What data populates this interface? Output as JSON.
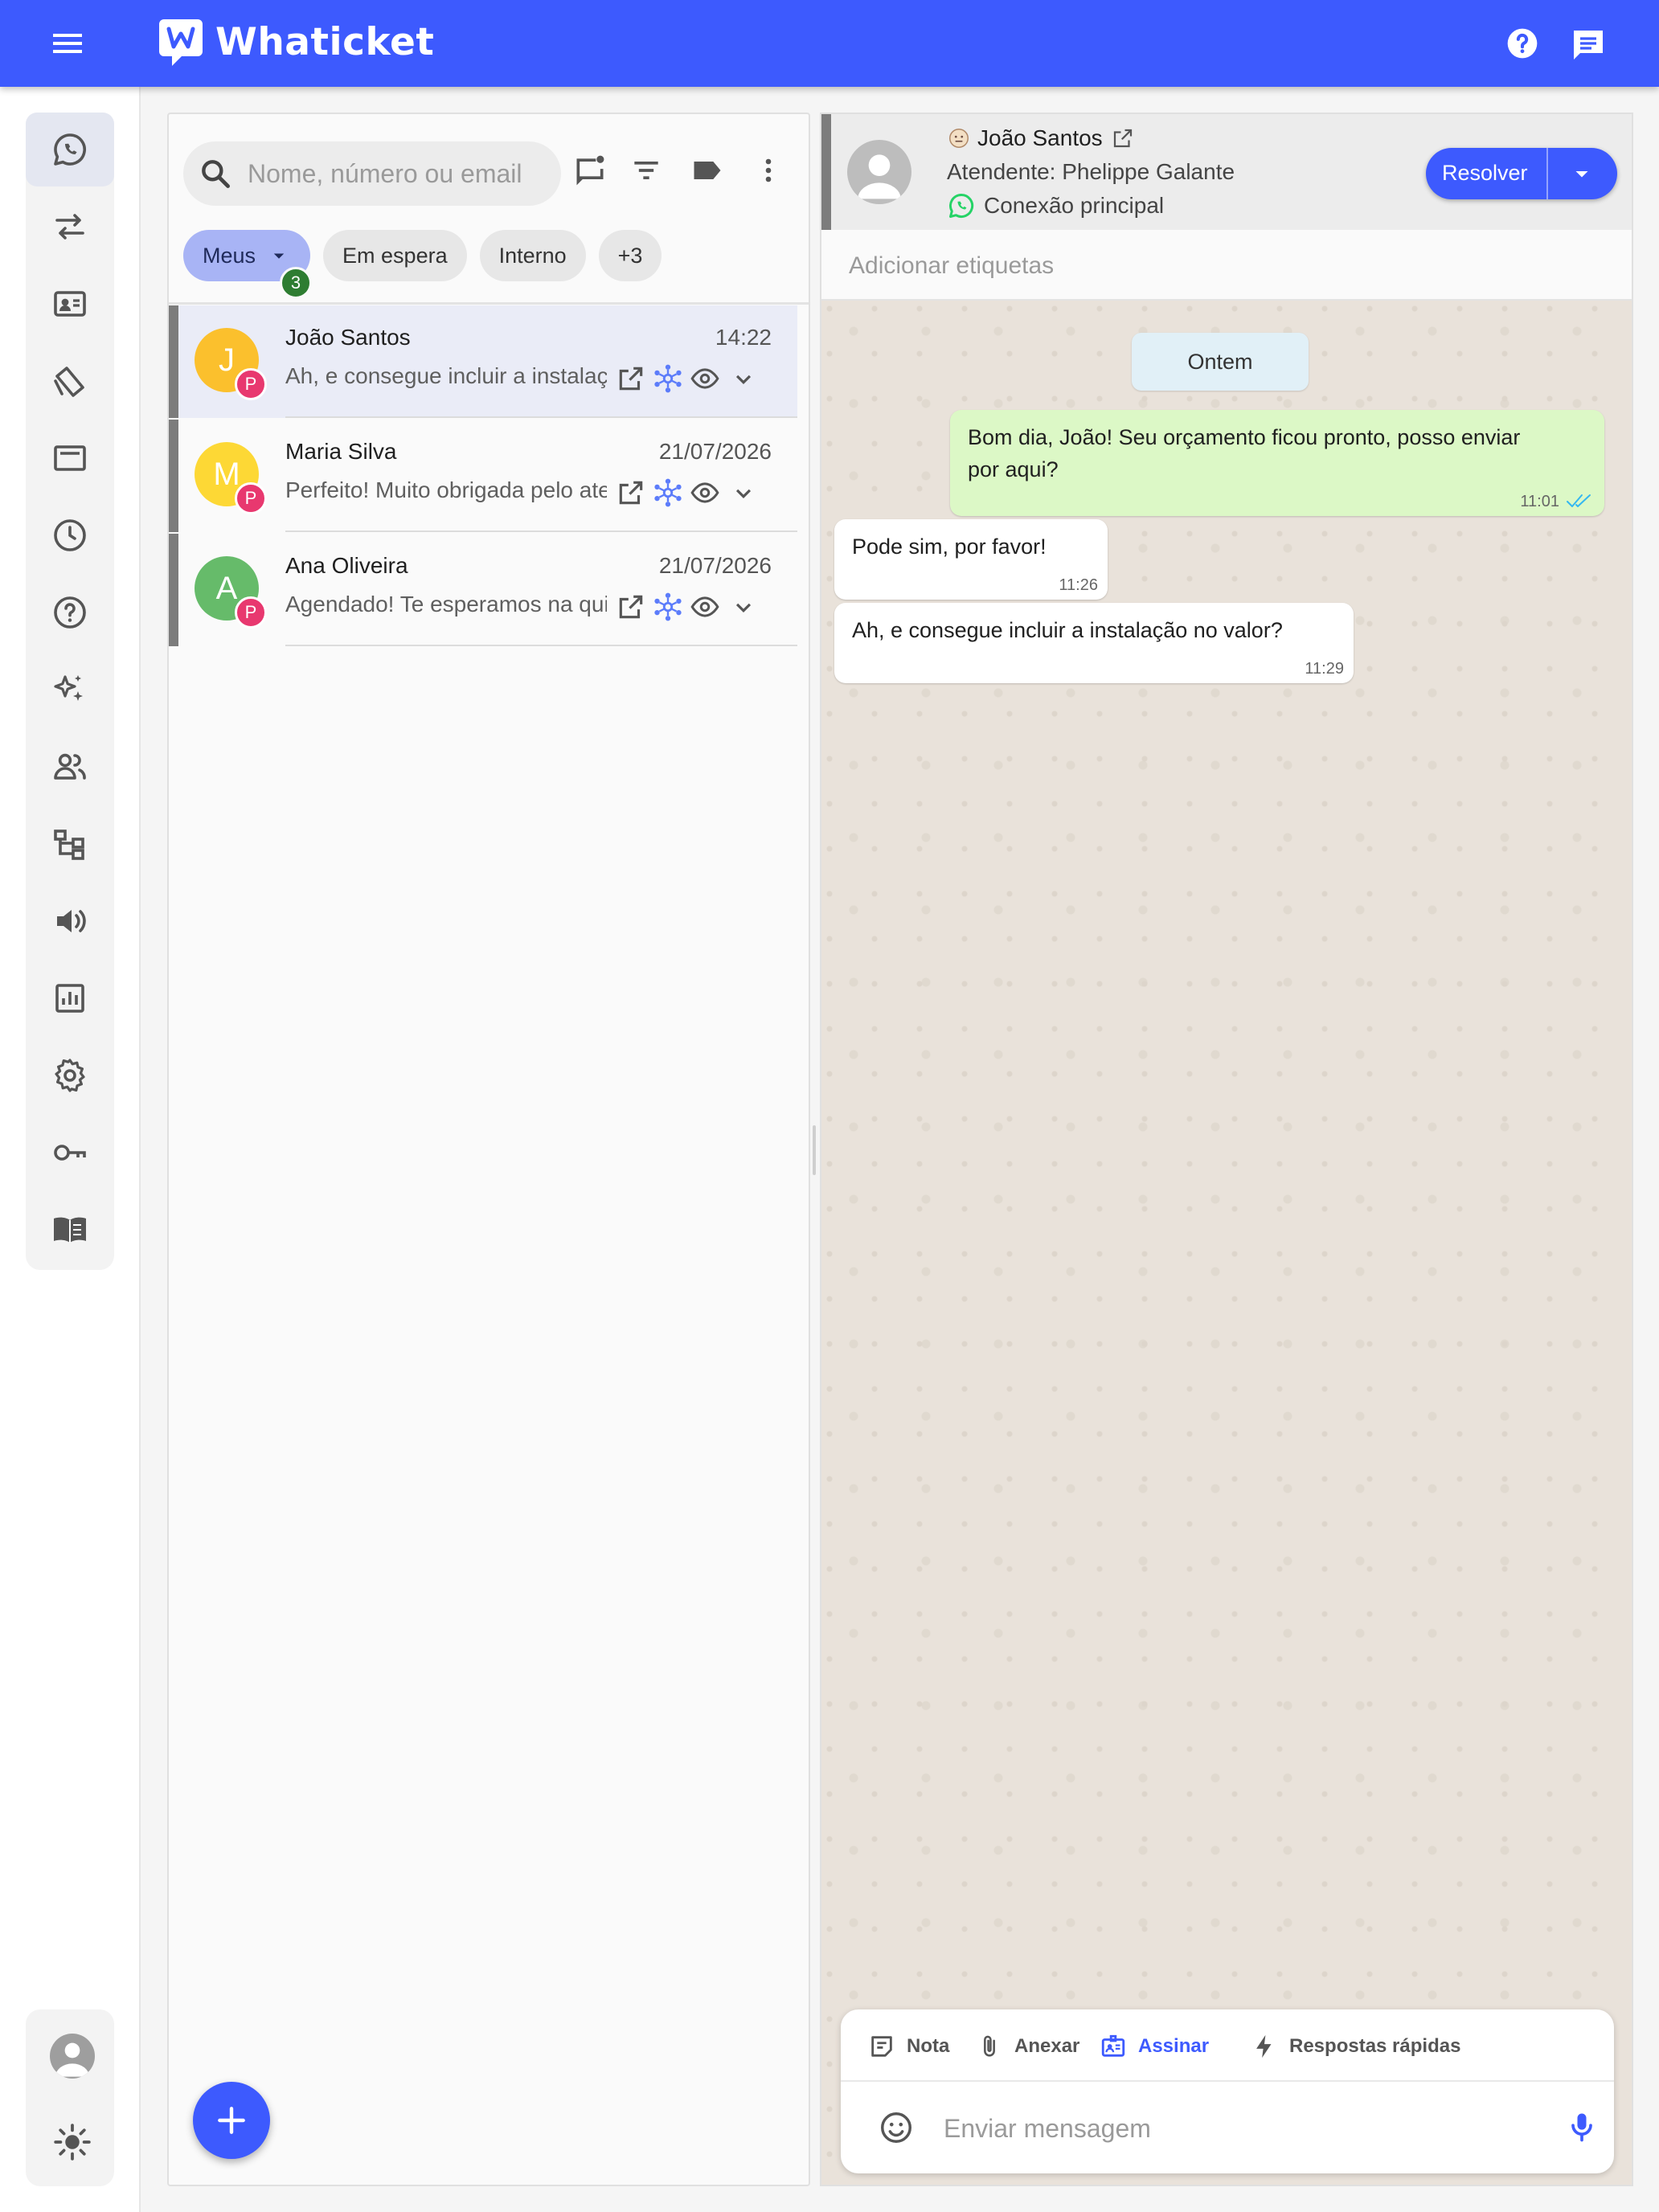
{
  "app": {
    "name": "Whaticket",
    "brand_color": "#3d5afe"
  },
  "header_icons": [
    "menu-icon",
    "help-icon",
    "chat-icon"
  ],
  "sidebar": {
    "items": [
      {
        "name": "whatsapp-icon",
        "active": true
      },
      {
        "name": "transfer-icon"
      },
      {
        "name": "contacts-icon"
      },
      {
        "name": "tags-icon"
      },
      {
        "name": "quick-messages-icon"
      },
      {
        "name": "schedule-icon"
      },
      {
        "name": "help-icon"
      },
      {
        "name": "ai-sparkle-icon"
      },
      {
        "name": "users-icon"
      },
      {
        "name": "flow-builder-icon"
      },
      {
        "name": "campaigns-icon"
      },
      {
        "name": "reports-icon"
      },
      {
        "name": "settings-icon"
      },
      {
        "name": "api-key-icon"
      },
      {
        "name": "docs-icon"
      }
    ],
    "bottom": [
      "profile-avatar",
      "theme-toggle-icon"
    ]
  },
  "tickets_panel": {
    "search_placeholder": "Nome, número ou email",
    "tabs": [
      {
        "label": "Meus",
        "badge": "3",
        "selected": true
      },
      {
        "label": "Em espera"
      },
      {
        "label": "Interno"
      },
      {
        "label": "+3"
      }
    ],
    "tickets": [
      {
        "initial": "J",
        "avatar_color": "#fbc02d",
        "tag": "P",
        "name": "João Santos",
        "time": "14:22",
        "preview": "Ah, e consegue incluir a instalação no valor?",
        "selected": true
      },
      {
        "initial": "M",
        "avatar_color": "#fdd835",
        "tag": "P",
        "name": "Maria Silva",
        "time": "21/07/2026",
        "preview": "Perfeito! Muito obrigada pelo atendimento"
      },
      {
        "initial": "A",
        "avatar_color": "#66bb6a",
        "tag": "P",
        "name": "Ana Oliveira",
        "time": "21/07/2026",
        "preview": "Agendado! Te esperamos na quinta"
      }
    ]
  },
  "chat": {
    "contact_name": "João Santos",
    "attendant": "Atendente: Phelippe Galante",
    "connection": "Conexão principal",
    "resolve_label": "Resolver",
    "labels_placeholder": "Adicionar etiquetas",
    "date_separator": "Ontem",
    "messages": [
      {
        "direction": "out",
        "lines": [
          "Bom dia, João! Seu orçamento ficou pronto, posso enviar",
          "por aqui?"
        ],
        "time": "11:01",
        "read": true
      },
      {
        "direction": "in",
        "lines": [
          "Pode sim, por favor!"
        ],
        "time": "11:26"
      },
      {
        "direction": "in",
        "lines": [
          "Ah, e consegue incluir a instalação no valor?"
        ],
        "time": "11:29"
      }
    ],
    "composer": {
      "tools": [
        "Nota",
        "Anexar",
        "Assinar",
        "Respostas rápidas"
      ],
      "placeholder": "Enviar mensagem"
    }
  }
}
